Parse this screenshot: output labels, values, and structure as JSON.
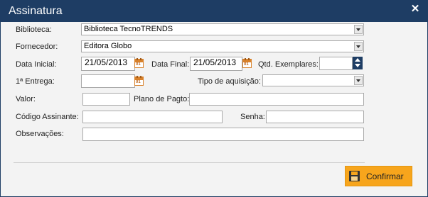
{
  "window": {
    "title": "Assinatura",
    "close_icon": "close-icon"
  },
  "form": {
    "biblioteca": {
      "label": "Biblioteca:",
      "value": "Biblioteca TecnoTRENDS"
    },
    "fornecedor": {
      "label": "Fornecedor:",
      "value": "Editora Globo"
    },
    "data_inicial": {
      "label": "Data Inicial:",
      "value": "21/05/2013"
    },
    "data_final": {
      "label": "Data Final:",
      "value": "21/05/2013"
    },
    "qtd_exemplares": {
      "label": "Qtd. Exemplares:",
      "value": ""
    },
    "primeira_entrega": {
      "label": "1ª Entrega:",
      "value": ""
    },
    "tipo_aquisicao": {
      "label": "Tipo de aquisição:",
      "value": ""
    },
    "valor": {
      "label": "Valor:",
      "value": ""
    },
    "plano_pagto": {
      "label": "Plano de Pagto:",
      "value": ""
    },
    "codigo_assinante": {
      "label": "Código Assinante:",
      "value": ""
    },
    "senha": {
      "label": "Senha:",
      "value": ""
    },
    "observacoes": {
      "label": "Observações:",
      "value": ""
    },
    "calendar_icon_text": "01"
  },
  "actions": {
    "confirm_label": "Confirmar"
  },
  "colors": {
    "titlebar": "#1e3d64",
    "accent": "#f7a51c",
    "calendar": "#d9822b"
  }
}
